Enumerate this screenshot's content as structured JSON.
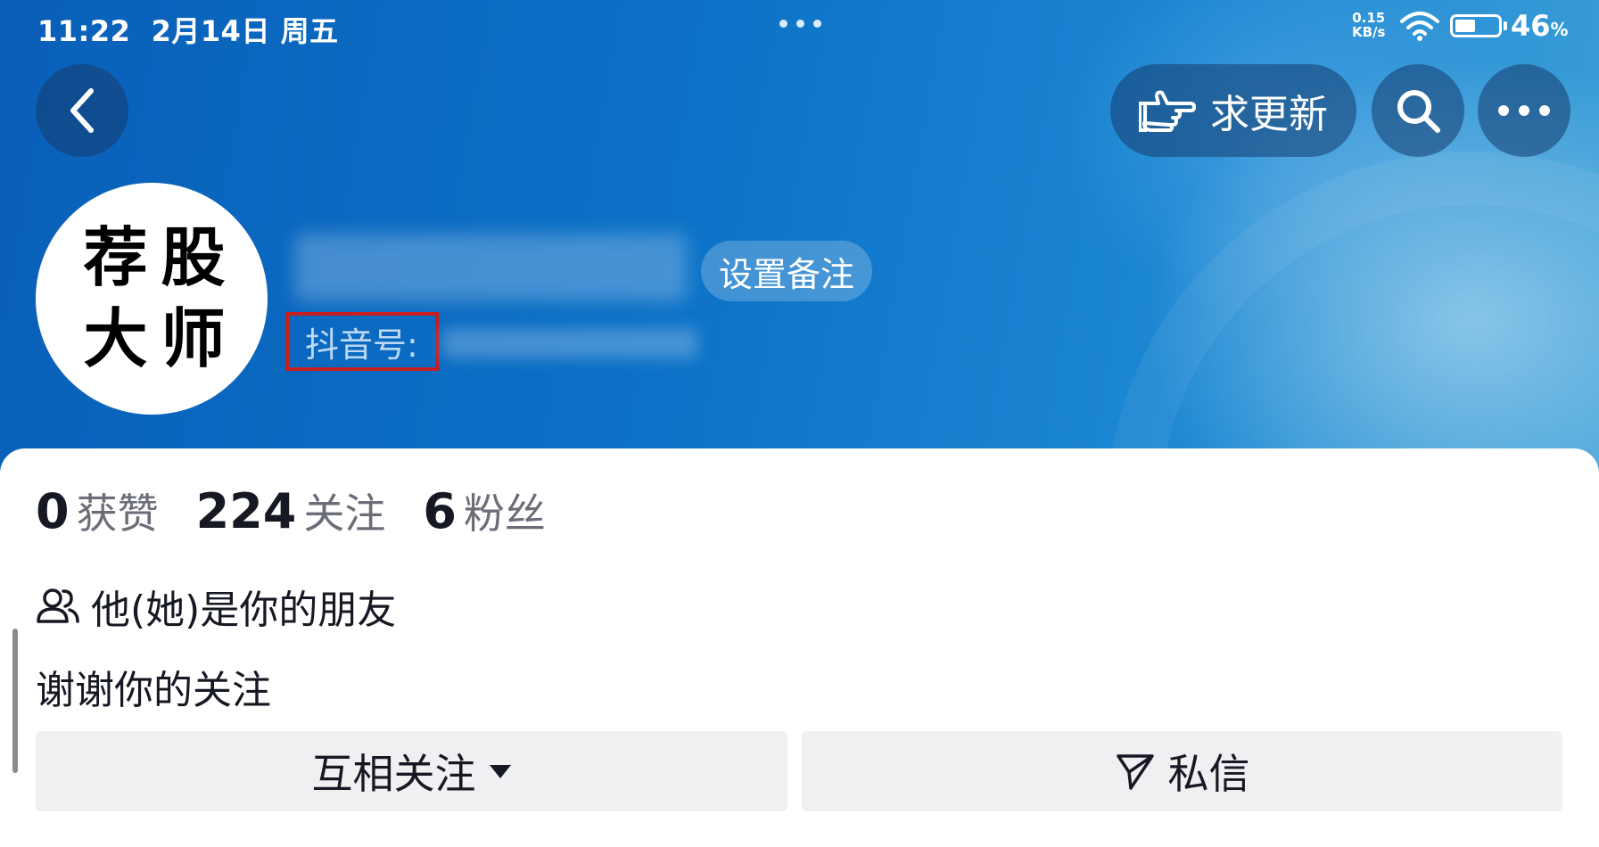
{
  "status_bar": {
    "time": "11:22",
    "date": "2月14日",
    "weekday": "周五",
    "net_speed_value": "0.15",
    "net_speed_unit": "KB/s",
    "battery": "46",
    "battery_unit": "%"
  },
  "header": {
    "update_label": "求更新",
    "icons": [
      "back-icon",
      "pointing-hand-icon",
      "search-icon",
      "more-icon"
    ]
  },
  "profile": {
    "avatar_chars": [
      "荐",
      "股",
      "大",
      "师"
    ],
    "remark_label": "设置备注",
    "douyin_id_label": "抖音号:"
  },
  "stats": [
    {
      "num": "0",
      "label": "获赞"
    },
    {
      "num": "224",
      "label": "关注"
    },
    {
      "num": "6",
      "label": "粉丝"
    }
  ],
  "friend_text": "他(她)是你的朋友",
  "bio": "谢谢你的关注",
  "actions": {
    "follow_label": "互相关注",
    "message_label": "私信"
  },
  "colors": {
    "banner": "#0b70c6",
    "highlight_box": "#c81e1e",
    "button_bg": "#f0f0f2",
    "text_primary": "#161823",
    "text_secondary": "#6b6d78"
  }
}
